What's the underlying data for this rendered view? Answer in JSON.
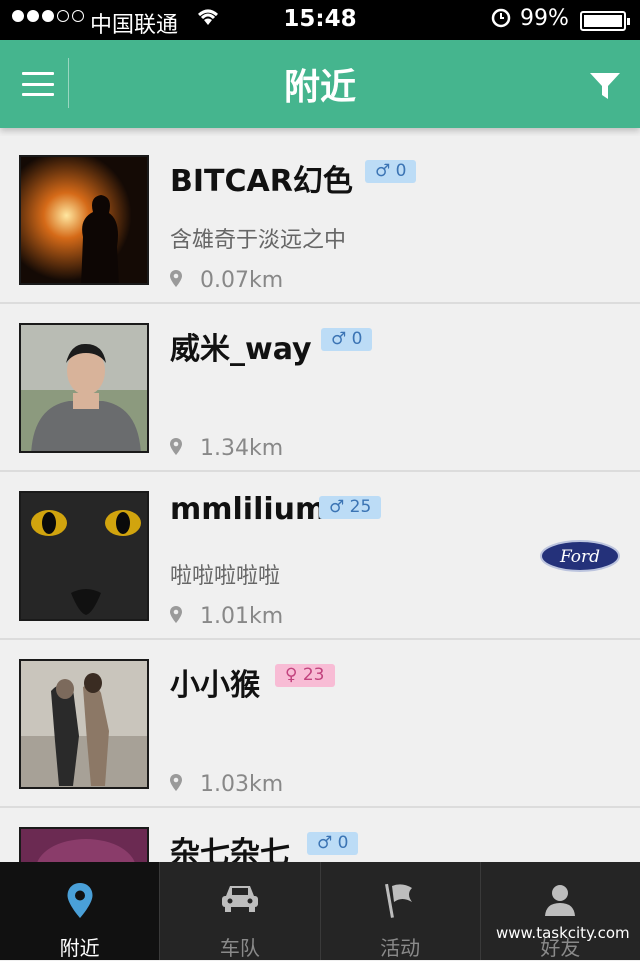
{
  "status_bar": {
    "carrier": "中国联通",
    "time": "15:48",
    "battery": "99%"
  },
  "nav": {
    "title": "附近"
  },
  "users": [
    {
      "name": "BITCAR幻色",
      "gender": "♂",
      "count": "0",
      "signature": "含雄奇于淡远之中",
      "distance": "0.07km"
    },
    {
      "name": "威米_way",
      "gender": "♂",
      "count": "0",
      "signature": "",
      "distance": "1.34km"
    },
    {
      "name": "mmlilium",
      "gender": "♂",
      "count": "25",
      "signature": "啦啦啦啦啦",
      "distance": "1.01km",
      "car_brand": "Ford"
    },
    {
      "name": "小小猴",
      "gender": "♀",
      "count": "23",
      "signature": "",
      "distance": "1.03km"
    },
    {
      "name": "杂七杂七",
      "gender": "♂",
      "count": "0",
      "signature": "",
      "distance": ""
    }
  ],
  "tabs": [
    {
      "label": "附近",
      "icon": "location-pin-icon",
      "active": true
    },
    {
      "label": "车队",
      "icon": "car-icon",
      "active": false
    },
    {
      "label": "活动",
      "icon": "flag-icon",
      "active": false
    },
    {
      "label": "好友",
      "icon": "person-icon",
      "active": false
    }
  ],
  "watermark": "www.taskcity.com",
  "colors": {
    "accent": "#45b58e",
    "male_badge": "#bcdcf6",
    "female_badge": "#f8bcd5",
    "tabbar": "#252525"
  }
}
